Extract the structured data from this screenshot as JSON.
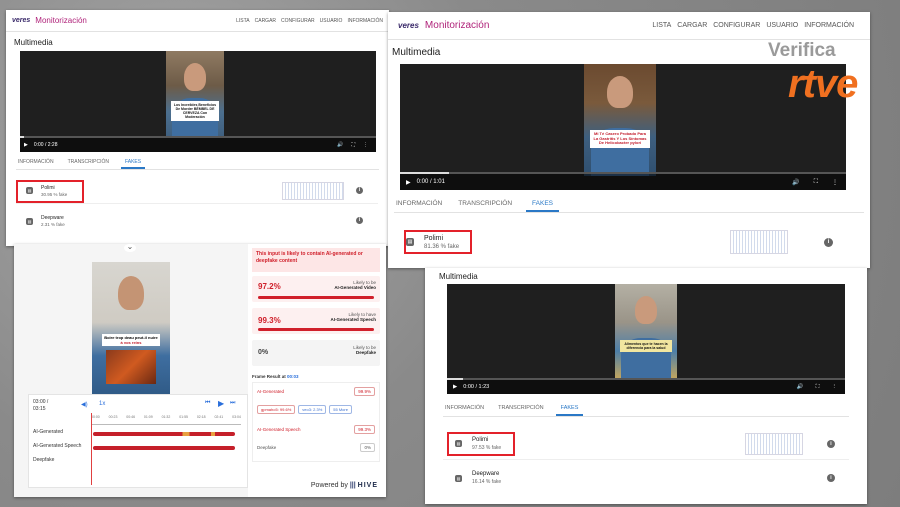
{
  "brand_color": "#b0237a",
  "highlight_color": "#e3212a",
  "panel_a": {
    "logo": "veres",
    "title": "Monitorización",
    "nav": [
      "LISTA",
      "CARGAR",
      "CONFIGURAR",
      "USUARIO",
      "INFORMACIÓN"
    ],
    "section": "Multimedia",
    "caption": "Los Increíbles Beneficios De Morder BÉMBEL DE CERVEZA Con Moderación",
    "time": "0:00 / 2:28",
    "tabs": [
      "INFORMACIÓN",
      "TRANSCRIPCIÓN",
      "FAKES"
    ],
    "active_tab": "FAKES",
    "rows": [
      {
        "name": "Polimi",
        "pct": "30.95 % fake",
        "highlighted": true
      },
      {
        "name": "Deepware",
        "pct": "2.31 % fake",
        "highlighted": false
      }
    ]
  },
  "panel_b": {
    "logo": "veres",
    "title": "Monitorización",
    "nav": [
      "LISTA",
      "CARGAR",
      "CONFIGURAR",
      "USUARIO",
      "INFORMACIÓN"
    ],
    "section": "Multimedia",
    "caption": "Mi Té Casero Probado Para La Gastritis Y Los Síntomas De Helicobacter pylori",
    "time": "0:00 / 1:01",
    "tabs": [
      "INFORMACIÓN",
      "TRANSCRIPCIÓN",
      "FAKES"
    ],
    "active_tab": "FAKES",
    "rows": [
      {
        "name": "Polimi",
        "pct": "81.36 % fake",
        "highlighted": true
      }
    ]
  },
  "panel_c": {
    "section": "Multimedia",
    "caption": "Alimentos que te hacen la diferencia para la salud",
    "time": "0:00 / 1:23",
    "tabs": [
      "INFORMACIÓN",
      "TRANSCRIPCIÓN",
      "FAKES"
    ],
    "active_tab": "FAKES",
    "rows": [
      {
        "name": "Polimi",
        "pct": "97.53 % fake",
        "highlighted": true
      },
      {
        "name": "Deepware",
        "pct": "16.14 % fake",
        "highlighted": false
      }
    ]
  },
  "hive": {
    "caption_line1": "Boire trop deau peut-il nuire",
    "caption_line2": "à vos reins",
    "time_current": "03:00 /",
    "time_total": "03:15",
    "speed": "1x",
    "ticks": [
      "00:00",
      "00:23",
      "00:46",
      "01:09",
      "01:32",
      "01:55",
      "02:18",
      "02:41",
      "03:04"
    ],
    "timeline_rows": [
      "AI-Generated",
      "AI-Generated Speech",
      "Deepfake"
    ],
    "alert": "This input is likely to contain AI-generated or deepfake content",
    "scores": [
      {
        "value": "97.2%",
        "label_top": "Likely to be",
        "label_main": "AI-Generated Video",
        "tone": "red"
      },
      {
        "value": "99.3%",
        "label_top": "Likely to have",
        "label_main": "AI-Generated Speech",
        "tone": "red"
      },
      {
        "value": "0%",
        "label_top": "Likely to be",
        "label_main": "Deepfake",
        "tone": "grey"
      }
    ],
    "frame_result_label": "Frame Result at",
    "frame_result_time": "00:03",
    "frame_items": [
      {
        "name": "AI-Generated",
        "value": "99.9%"
      },
      {
        "name": "AI-Generated Speech",
        "value": "99.3%"
      },
      {
        "name": "Deepfake",
        "value": "0%"
      }
    ],
    "chips": [
      "gpmaho5: 99.6%",
      "veo3: 2.3%",
      "55 More"
    ],
    "powered_by": "Powered by",
    "powered_brand": "HIVE"
  },
  "watermark": {
    "line1": "Verifica",
    "line2": "rtve"
  }
}
